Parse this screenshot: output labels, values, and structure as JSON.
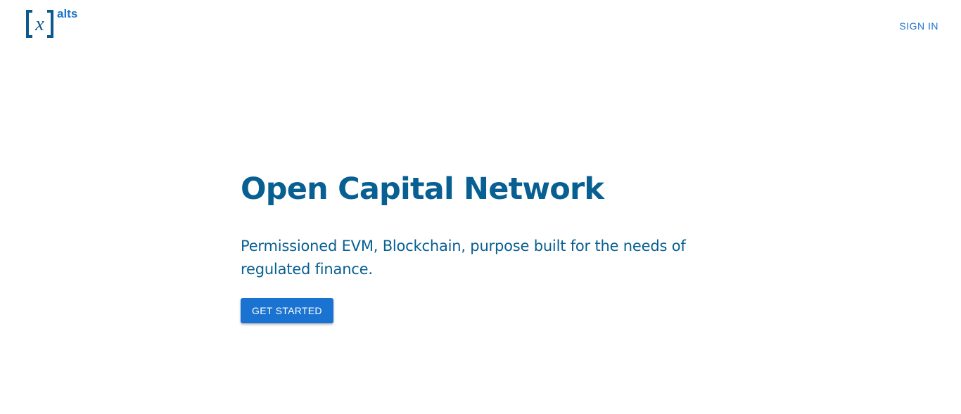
{
  "header": {
    "logo": {
      "glyph": "x",
      "wordmark": "alts",
      "color": "#0c5a8c"
    },
    "sign_in_label": "SIGN IN"
  },
  "hero": {
    "title": "Open Capital Network",
    "subtitle": "Permissioned EVM, Blockchain, purpose built for the needs of regulated finance.",
    "cta_label": "GET STARTED"
  },
  "colors": {
    "primary_text": "#075f92",
    "button": "#1a73d0",
    "link": "#1f74c9",
    "background": "#ffffff"
  }
}
